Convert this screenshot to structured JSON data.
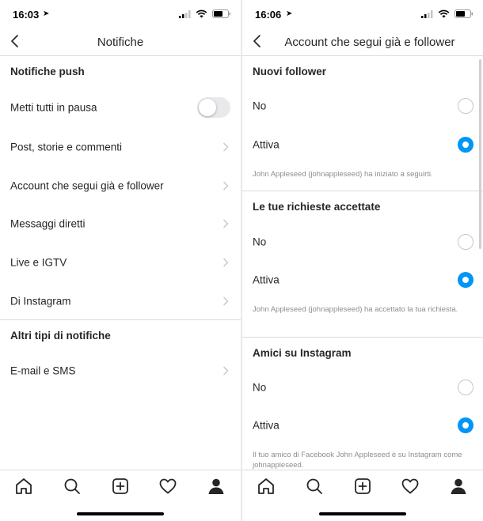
{
  "left": {
    "status": {
      "time": "16:03"
    },
    "nav": {
      "title": "Notifiche"
    },
    "push_section": "Notifiche push",
    "pause_label": "Metti tutti in pausa",
    "pause_on": false,
    "items": [
      {
        "label": "Post, storie e commenti"
      },
      {
        "label": "Account che segui già e follower"
      },
      {
        "label": "Messaggi diretti"
      },
      {
        "label": "Live e IGTV"
      },
      {
        "label": "Di Instagram"
      }
    ],
    "other_section": "Altri tipi di notifiche",
    "other_items": [
      {
        "label": "E-mail e SMS"
      }
    ]
  },
  "right": {
    "status": {
      "time": "16:06"
    },
    "nav": {
      "title": "Account che segui già e follower"
    },
    "sections": [
      {
        "title": "Nuovi follower",
        "options": [
          "No",
          "Attiva"
        ],
        "selected": "Attiva",
        "description": "John Appleseed (johnappleseed) ha iniziato a seguirti."
      },
      {
        "title": "Le tue richieste accettate",
        "options": [
          "No",
          "Attiva"
        ],
        "selected": "Attiva",
        "description": "John Appleseed (johnappleseed) ha accettato la tua richiesta."
      },
      {
        "title": "Amici su Instagram",
        "options": [
          "No",
          "Attiva"
        ],
        "selected": "Attiva",
        "description": "Il tuo amico di Facebook John Appleseed è su Instagram come johnappleseed."
      }
    ]
  },
  "tabbar": {
    "tabs": [
      "home-icon",
      "search-icon",
      "new-post-icon",
      "activity-heart-icon",
      "profile-icon"
    ],
    "active": "profile-icon"
  },
  "colors": {
    "accent": "#0095f6",
    "text": "#262626",
    "secondary_text": "#8e8e8e",
    "separator": "#dbdbdb"
  }
}
